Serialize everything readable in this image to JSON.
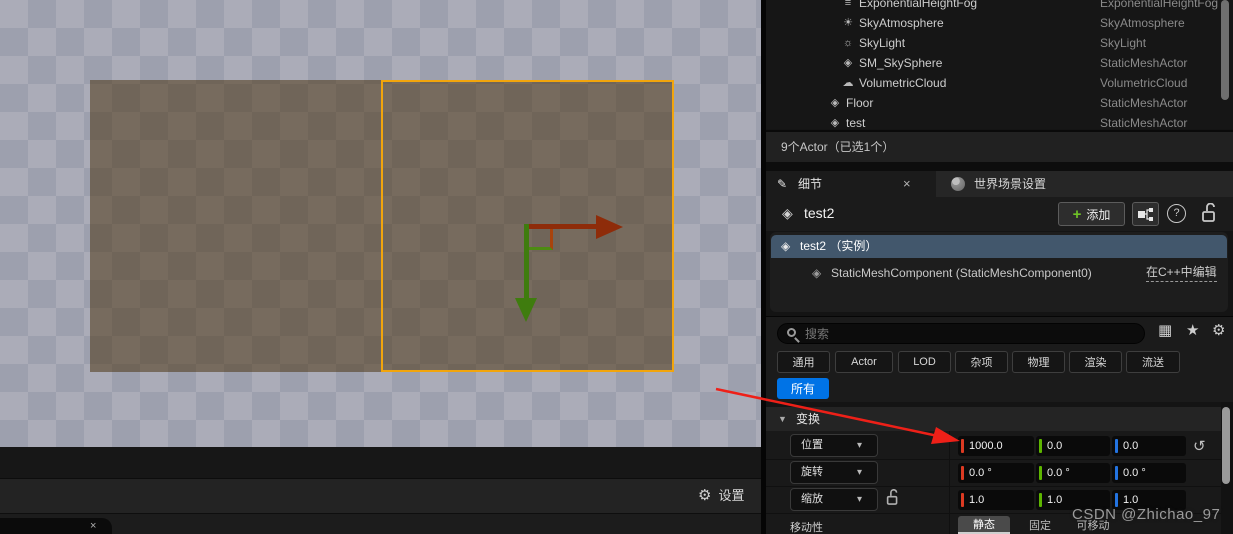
{
  "viewport": {
    "settings_label": "设置",
    "pill_close": "×",
    "selection_color": "#f2a50c"
  },
  "outliner": {
    "rows": [
      {
        "name": "ExponentialHeightFog",
        "type": "ExponentialHeightFog",
        "icon": "≡"
      },
      {
        "name": "SkyAtmosphere",
        "type": "SkyAtmosphere",
        "icon": "☀"
      },
      {
        "name": "SkyLight",
        "type": "SkyLight",
        "icon": "☼"
      },
      {
        "name": "SM_SkySphere",
        "type": "StaticMeshActor",
        "icon": "◈"
      },
      {
        "name": "VolumetricCloud",
        "type": "VolumetricCloud",
        "icon": "☁"
      },
      {
        "name": "Floor",
        "type": "StaticMeshActor",
        "icon": "◈"
      },
      {
        "name": "test",
        "type": "StaticMeshActor",
        "icon": "◈"
      }
    ],
    "status": "9个Actor（已选1个）"
  },
  "tabs": {
    "details_label": "细节",
    "details_close": "×",
    "world_label": "世界场景设置"
  },
  "details": {
    "actor_name": "test2",
    "add_label": "添加",
    "add_plus": "+",
    "help_label": "?",
    "instance_label": "test2 （实例）",
    "component_label": "StaticMeshComponent (StaticMeshComponent0)",
    "edit_link": "在C++中编辑",
    "search_placeholder": "搜索",
    "filters": [
      "通用",
      "Actor",
      "LOD",
      "杂项",
      "物理",
      "渲染",
      "流送"
    ],
    "all_label": "所有",
    "all_color": "#0073e6",
    "transform": {
      "section_label": "变换",
      "location_label": "位置",
      "rotation_label": "旋转",
      "scale_label": "缩放",
      "mobility_label": "移动性",
      "location": [
        "1000.0",
        "0.0",
        "0.0"
      ],
      "rotation": [
        "0.0 °",
        "0.0 °",
        "0.0 °"
      ],
      "scale": [
        "1.0",
        "1.0",
        "1.0"
      ],
      "mobility_options": [
        "静态",
        "固定",
        "可移动"
      ],
      "mobility_selected": "静态",
      "axis_colors": {
        "x": "#dc3a22",
        "y": "#5db500",
        "z": "#2373e0"
      }
    }
  },
  "annotation": {
    "watermark": "CSDN @Zhichao_97",
    "arrow_color": "#ee2018"
  }
}
